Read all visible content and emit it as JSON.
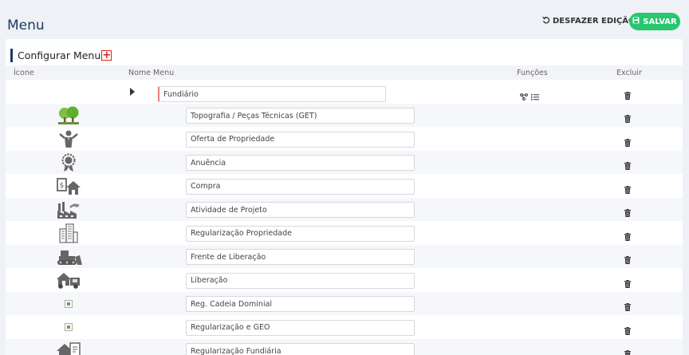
{
  "header": {
    "title": "Menu",
    "undo_label": "DESFAZER EDIÇÃO",
    "save_label": "SALVAR"
  },
  "section": {
    "title": "Configurar Menu",
    "add_symbol": "+"
  },
  "columns": {
    "icon": "Ícone",
    "name": "Nome Menu",
    "functions": "Funções",
    "delete": "Excluir"
  },
  "parent": {
    "name": "Fundiário"
  },
  "items": [
    {
      "name": "Topografia / Peças Técnicas (GET)",
      "icon": "tree-icon"
    },
    {
      "name": "Oferta de Propriedade",
      "icon": "person-offer-icon"
    },
    {
      "name": "Anuência",
      "icon": "seal-icon"
    },
    {
      "name": "Compra",
      "icon": "money-house-icon"
    },
    {
      "name": "Atividade de Projeto",
      "icon": "factory-icon"
    },
    {
      "name": "Regularização Propriedade",
      "icon": "buildings-icon"
    },
    {
      "name": "Frente de Liberação",
      "icon": "bulldozer-icon"
    },
    {
      "name": "Liberação",
      "icon": "truck-house-icon"
    },
    {
      "name": "Reg. Cadeia Dominial",
      "icon": "broken-image-icon"
    },
    {
      "name": "Regularização e GEO",
      "icon": "broken-image-icon"
    },
    {
      "name": "Regularização Fundiária",
      "icon": "house-document-icon"
    }
  ],
  "colors": {
    "save": "#28c76f",
    "title": "#1e3a5f",
    "add": "#e02020"
  }
}
